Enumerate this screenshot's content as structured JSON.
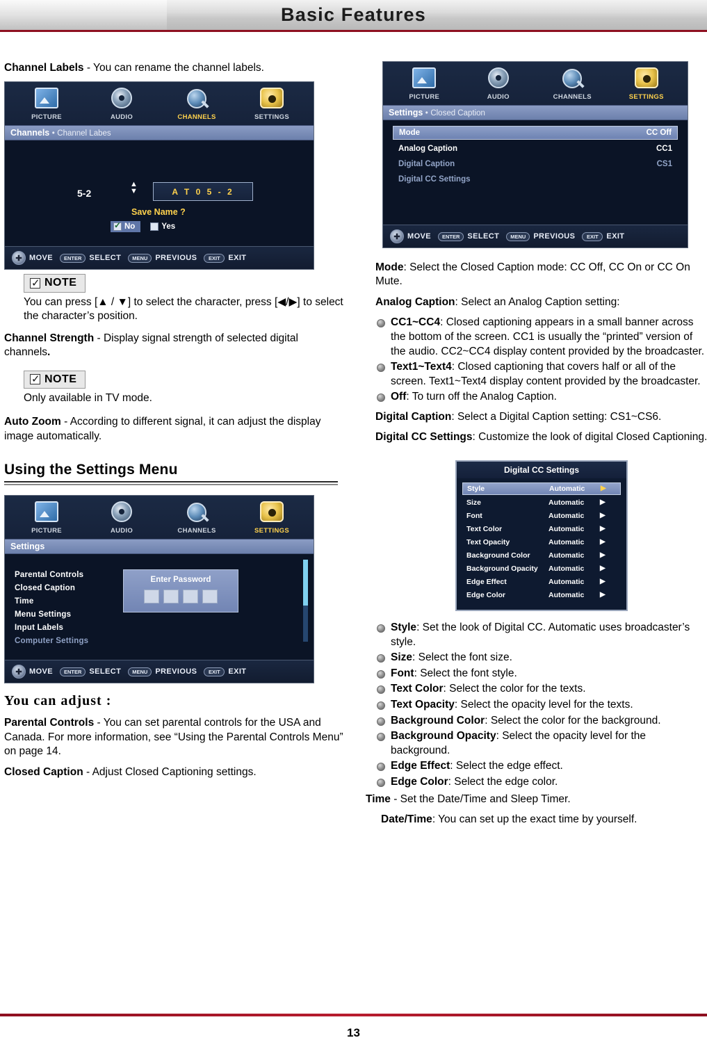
{
  "header": {
    "title": "Basic Features"
  },
  "page_number": "13",
  "left": {
    "channel_labels_para": {
      "term": "Channel Labels",
      "rest": " - You can rename the channel labels."
    },
    "osd_channel_labels": {
      "tabs": [
        {
          "label": "PICTURE",
          "icon": "picture-icon",
          "highlight": false
        },
        {
          "label": "AUDIO",
          "icon": "audio-icon",
          "highlight": false
        },
        {
          "label": "CHANNELS",
          "icon": "channels-icon",
          "highlight": true
        },
        {
          "label": "SETTINGS",
          "icon": "settings-icon",
          "highlight": false
        }
      ],
      "subbar_main": "Channels",
      "subbar_sep": "•",
      "subbar_sub": "Channel Labes",
      "channel_number": "5-2",
      "name_field": "A T 0 5 - 2",
      "save_prompt": "Save Name ?",
      "option_no": "No",
      "option_yes": "Yes",
      "footer": [
        {
          "key": "✚",
          "label": "MOVE",
          "round": true
        },
        {
          "key": "ENTER",
          "label": "SELECT",
          "round": false
        },
        {
          "key": "MENU",
          "label": "PREVIOUS",
          "round": false
        },
        {
          "key": "EXIT",
          "label": "EXIT",
          "round": false
        }
      ]
    },
    "note1": {
      "label": "NOTE",
      "text": "You can press [▲ / ▼] to select the character, press [◀/▶] to select the character’s position."
    },
    "channel_strength": {
      "term": "Channel Strength",
      "rest": " - Display signal strength of selected digital channels",
      "tail": "."
    },
    "note2": {
      "label": "NOTE",
      "text": "Only available in TV mode."
    },
    "auto_zoom": {
      "term": "Auto Zoom",
      "rest": " - According to different signal, it can adjust the display image automatically."
    },
    "section_heading": "Using the Settings Menu",
    "osd_settings": {
      "tabs": [
        {
          "label": "PICTURE",
          "icon": "picture-icon",
          "highlight": false
        },
        {
          "label": "AUDIO",
          "icon": "audio-icon",
          "highlight": false
        },
        {
          "label": "CHANNELS",
          "icon": "channels-icon",
          "highlight": false
        },
        {
          "label": "SETTINGS",
          "icon": "settings-icon",
          "highlight": true
        }
      ],
      "subbar_main": "Settings",
      "menu_items": [
        {
          "label": "Parental Controls",
          "dim": false
        },
        {
          "label": "Closed Caption",
          "dim": false
        },
        {
          "label": "Time",
          "dim": false
        },
        {
          "label": "Menu Settings",
          "dim": false
        },
        {
          "label": "Input Labels",
          "dim": false
        },
        {
          "label": "Computer Settings",
          "dim": true
        }
      ],
      "password_title": "Enter Password",
      "password_cells": 4,
      "footer": [
        {
          "key": "✚",
          "label": "MOVE",
          "round": true
        },
        {
          "key": "ENTER",
          "label": "SELECT",
          "round": false
        },
        {
          "key": "MENU",
          "label": "PREVIOUS",
          "round": false
        },
        {
          "key": "EXIT",
          "label": "EXIT",
          "round": false
        }
      ]
    },
    "you_can_adjust": "You can adjust :",
    "parental_controls": {
      "term": "Parental Controls",
      "rest": " - You can set parental controls for the USA and Canada. For more information, see “Using the Parental Controls Menu” on page 14."
    },
    "closed_caption": {
      "term": "Closed Caption",
      "rest": " - Adjust Closed Captioning settings."
    }
  },
  "right": {
    "osd_cc": {
      "tabs": [
        {
          "label": "PICTURE",
          "icon": "picture-icon",
          "highlight": false
        },
        {
          "label": "AUDIO",
          "icon": "audio-icon",
          "highlight": false
        },
        {
          "label": "CHANNELS",
          "icon": "channels-icon",
          "highlight": false
        },
        {
          "label": "SETTINGS",
          "icon": "settings-icon",
          "highlight": true
        }
      ],
      "subbar_main": "Settings",
      "subbar_sep": "•",
      "subbar_sub": "Closed Caption",
      "rows": [
        {
          "label": "Mode",
          "value": "CC Off",
          "selected": true,
          "dim": false
        },
        {
          "label": "Analog Caption",
          "value": "CC1",
          "selected": false,
          "dim": false
        },
        {
          "label": "Digital Caption",
          "value": "CS1",
          "selected": false,
          "dim": true
        },
        {
          "label": "Digital CC Settings",
          "value": "",
          "selected": false,
          "dim": true
        }
      ],
      "footer": [
        {
          "key": "✚",
          "label": "MOVE",
          "round": true
        },
        {
          "key": "ENTER",
          "label": "SELECT",
          "round": false
        },
        {
          "key": "MENU",
          "label": "PREVIOUS",
          "round": false
        },
        {
          "key": "EXIT",
          "label": "EXIT",
          "round": false
        }
      ]
    },
    "mode_para": {
      "term": "Mode",
      "rest": ": Select the Closed Caption mode: CC Off, CC On or CC On Mute."
    },
    "analog_caption_para": {
      "term": "Analog Caption",
      "rest": ": Select an Analog Caption setting:"
    },
    "analog_bullets": [
      {
        "term": "CC1~CC4",
        "rest": ": Closed captioning appears in a small banner across the bottom of the screen. CC1 is usually the “printed” version of the audio. CC2~CC4 display content provided by the broadcaster."
      },
      {
        "term": "Text1~Text4",
        "rest": ": Closed captioning that covers half or all of the screen. Text1~Text4 display content provided by the broadcaster."
      },
      {
        "term": "Off",
        "rest": ": To turn off the Analog Caption."
      }
    ],
    "digital_caption_para": {
      "term": "Digital Caption",
      "rest": ": Select a Digital Caption setting: CS1~CS6."
    },
    "digital_cc_settings_para": {
      "term": "Digital CC Settings",
      "rest": ": Customize the look of digital Closed Captioning."
    },
    "osd_dccs": {
      "title": "Digital CC Settings",
      "rows": [
        {
          "label": "Style",
          "value": "Automatic",
          "selected": true
        },
        {
          "label": "Size",
          "value": "Automatic",
          "selected": false
        },
        {
          "label": "Font",
          "value": "Automatic",
          "selected": false
        },
        {
          "label": "Text Color",
          "value": "Automatic",
          "selected": false
        },
        {
          "label": "Text Opacity",
          "value": "Automatic",
          "selected": false
        },
        {
          "label": "Background Color",
          "value": "Automatic",
          "selected": false
        },
        {
          "label": "Background Opacity",
          "value": "Automatic",
          "selected": false
        },
        {
          "label": "Edge Effect",
          "value": "Automatic",
          "selected": false
        },
        {
          "label": "Edge Color",
          "value": "Automatic",
          "selected": false
        }
      ],
      "arrow": "▶"
    },
    "dccs_bullets": [
      {
        "term": "Style",
        "rest": ": Set the look of Digital CC. Automatic uses broadcaster’s style."
      },
      {
        "term": "Size",
        "rest": ": Select the font size."
      },
      {
        "term": "Font",
        "rest": ": Select the font style."
      },
      {
        "term": "Text Color",
        "rest": ": Select the color for the texts."
      },
      {
        "term": "Text Opacity",
        "rest": ": Select the opacity level for the texts."
      },
      {
        "term": "Background Color",
        "rest": ": Select the color for the background."
      },
      {
        "term": "Background Opacity",
        "rest": ": Select the opacity level for the background."
      },
      {
        "term": "Edge Effect",
        "rest": ": Select the edge effect."
      },
      {
        "term": "Edge Color",
        "rest": ": Select the edge color."
      }
    ],
    "time_para": {
      "term": "Time",
      "rest": " - Set the Date/Time and Sleep Timer."
    },
    "datetime_para": {
      "term": "Date/Time",
      "rest": ": You can set up the exact time by yourself."
    }
  }
}
